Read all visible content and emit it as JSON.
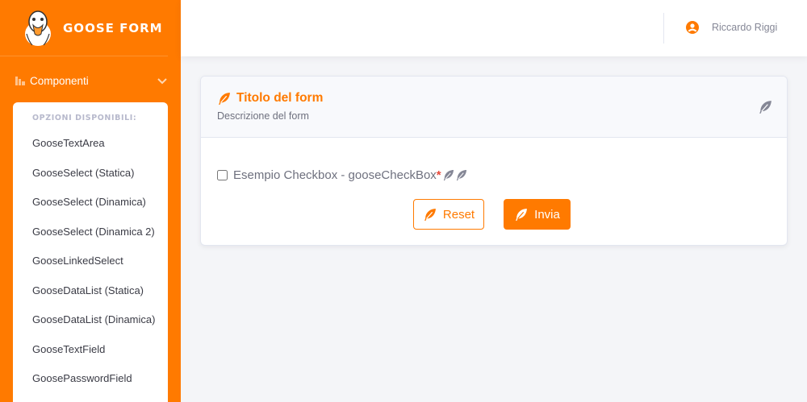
{
  "brand": {
    "name": "GOOSE FORM",
    "logo": "goose-logo"
  },
  "sidebar": {
    "section_label": "Componenti",
    "submenu_heading": "OPZIONI DISPONIBILI:",
    "items": [
      {
        "label": "GooseTextArea"
      },
      {
        "label": "GooseSelect (Statica)"
      },
      {
        "label": "GooseSelect (Dinamica)"
      },
      {
        "label": "GooseSelect (Dinamica 2)"
      },
      {
        "label": "GooseLinkedSelect"
      },
      {
        "label": "GooseDataList (Statica)"
      },
      {
        "label": "GooseDataList (Dinamica)"
      },
      {
        "label": "GooseTextField"
      },
      {
        "label": "GoosePasswordField"
      }
    ]
  },
  "topbar": {
    "user_name": "Riccardo Riggi",
    "user_icon": "user-circle-icon"
  },
  "form": {
    "title": "Titolo del form",
    "description": "Descrizione del form",
    "checkbox_label": "Esempio Checkbox - gooseCheckBox",
    "required_mark": "*",
    "reset_label": "Reset",
    "submit_label": "Invia"
  },
  "colors": {
    "accent": "#ff7a00",
    "required": "#e74a3b",
    "icon_gray": "#858796"
  }
}
